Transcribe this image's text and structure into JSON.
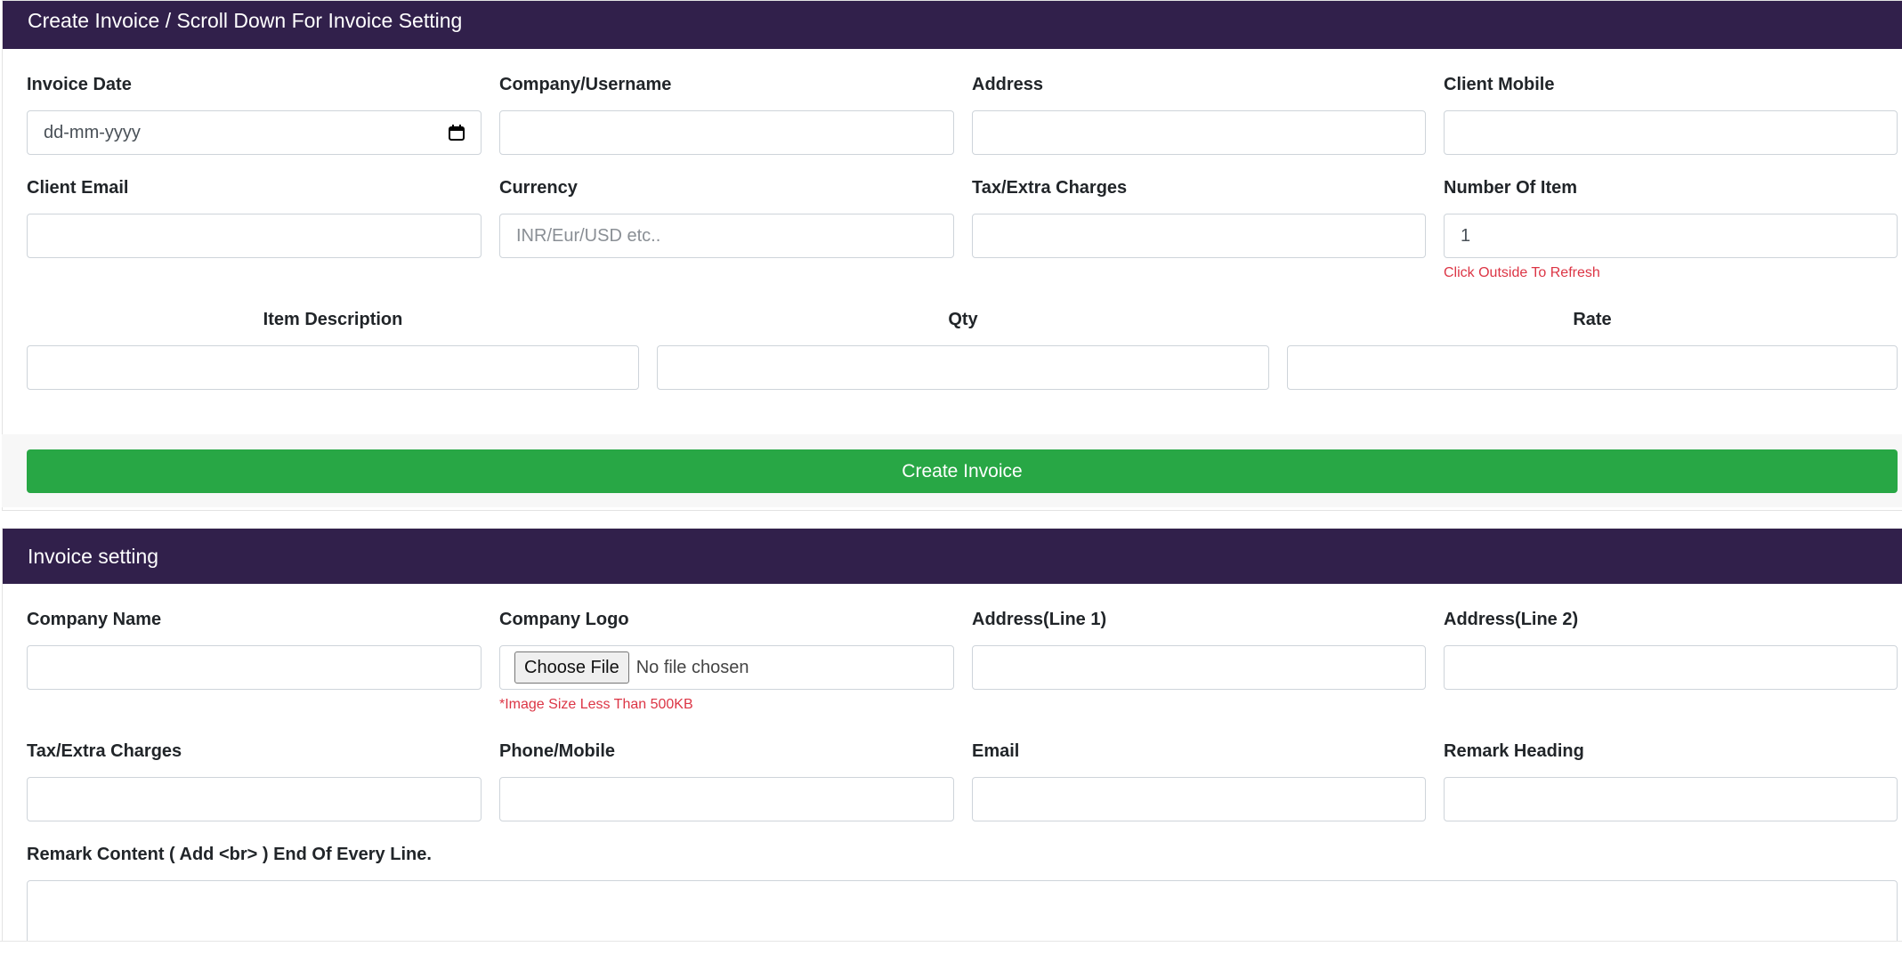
{
  "create_card": {
    "header": "Create Invoice / Scroll Down For Invoice Setting",
    "fields": {
      "invoice_date": {
        "label": "Invoice Date",
        "placeholder": "dd-mm-yyyy"
      },
      "company_username": {
        "label": "Company/Username",
        "value": ""
      },
      "address": {
        "label": "Address",
        "value": ""
      },
      "client_mobile": {
        "label": "Client Mobile",
        "value": ""
      },
      "client_email": {
        "label": "Client Email",
        "value": ""
      },
      "currency": {
        "label": "Currency",
        "placeholder": "INR/Eur/USD etc.."
      },
      "tax_extra": {
        "label": "Tax/Extra Charges",
        "value": ""
      },
      "number_of_item": {
        "label": "Number Of Item",
        "value": "1",
        "hint": "Click Outside To Refresh"
      }
    },
    "items": {
      "description_label": "Item Description",
      "qty_label": "Qty",
      "rate_label": "Rate"
    },
    "submit_label": "Create Invoice"
  },
  "setting_card": {
    "header": "Invoice setting",
    "fields": {
      "company_name": {
        "label": "Company Name"
      },
      "company_logo": {
        "label": "Company Logo",
        "button": "Choose File",
        "status": "No file chosen",
        "hint": "*Image Size Less Than 500KB"
      },
      "address_line1": {
        "label": "Address(Line 1)"
      },
      "address_line2": {
        "label": "Address(Line 2)"
      },
      "tax_extra": {
        "label": "Tax/Extra Charges"
      },
      "phone_mobile": {
        "label": "Phone/Mobile"
      },
      "email": {
        "label": "Email"
      },
      "remark_heading": {
        "label": "Remark Heading"
      },
      "remark_content": {
        "label": "Remark Content ( Add <br> ) End Of Every Line."
      }
    }
  },
  "icons": {
    "calendar": "calendar-icon"
  },
  "colors": {
    "header_bg": "#31204b",
    "button_green": "#28a745",
    "hint_red": "#dc3545"
  }
}
